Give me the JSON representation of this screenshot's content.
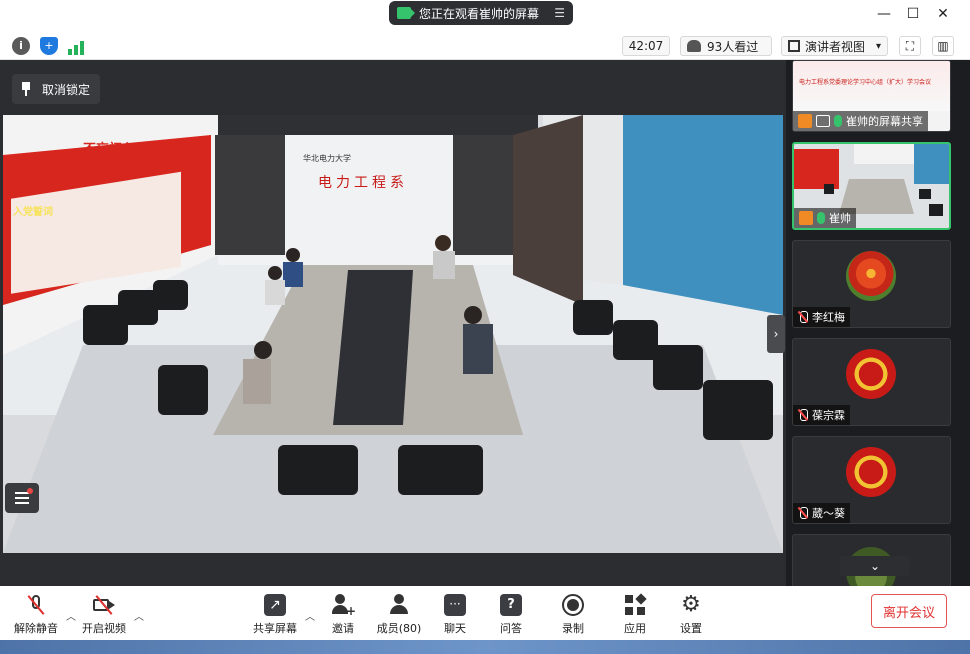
{
  "titlebar": {
    "share_notice": "您正在观看崔帅的屏幕",
    "minimize": "—",
    "maximize": "☐",
    "close": "✕"
  },
  "toolbar": {
    "info": "i",
    "timer": "42:07",
    "viewers": "93人看过",
    "view_mode": "演讲者视图",
    "view_caret": "▾"
  },
  "stage": {
    "unlock_label": "取消锁定",
    "banner_slogan": "不忘初心 牢记使命",
    "room_sign_small": "华北电力大学",
    "room_sign_main": "电力工程系",
    "oath_title": "入党誓词"
  },
  "sidebar": {
    "participants": [
      {
        "name": "崔帅的屏幕共享",
        "kind": "screen"
      },
      {
        "name": "崔帅",
        "kind": "camera",
        "mic": "on"
      },
      {
        "name": "李红梅",
        "kind": "avatar",
        "mic": "off"
      },
      {
        "name": "葆宗霖",
        "kind": "avatar",
        "mic": "off"
      },
      {
        "name": "葳～葵",
        "kind": "avatar",
        "mic": "off"
      },
      {
        "name": "",
        "kind": "avatar",
        "mic": "off"
      }
    ],
    "share_thumb_banner": "电力工程系党委理论学习中心组（扩大）学习会议",
    "collapse": "⌄"
  },
  "bottombar": {
    "unmute": "解除静音",
    "start_video": "开启视频",
    "share_screen": "共享屏幕",
    "invite": "邀请",
    "members": "成员(80)",
    "chat": "聊天",
    "qa": "问答",
    "record": "录制",
    "apps": "应用",
    "settings": "设置",
    "leave": "离开会议"
  },
  "colors": {
    "accent_green": "#35c46b",
    "leave_red": "#e03131",
    "banner_red": "#d7261e"
  }
}
